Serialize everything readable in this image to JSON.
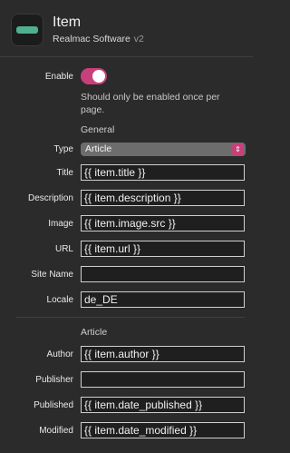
{
  "header": {
    "title": "Item",
    "vendor": "Realmac Software",
    "version": "v2"
  },
  "enable": {
    "label": "Enable",
    "on": true,
    "note": "Should only be enabled once per page."
  },
  "general": {
    "section_title": "General",
    "type_label": "Type",
    "type_value": "Article",
    "fields": [
      {
        "label": "Title",
        "value": "{{ item.title }}"
      },
      {
        "label": "Description",
        "value": "{{ item.description }}"
      },
      {
        "label": "Image",
        "value": "{{ item.image.src }}"
      },
      {
        "label": "URL",
        "value": "{{ item.url }}"
      },
      {
        "label": "Site Name",
        "value": ""
      },
      {
        "label": "Locale",
        "value": "de_DE"
      }
    ]
  },
  "article": {
    "section_title": "Article",
    "fields": [
      {
        "label": "Author",
        "value": "{{ item.author }}"
      },
      {
        "label": "Publisher",
        "value": ""
      },
      {
        "label": "Published",
        "value": "{{ item.date_published }}"
      },
      {
        "label": "Modified",
        "value": "{{ item.date_modified }}"
      }
    ]
  },
  "colors": {
    "background": "#2b2b2b",
    "accent": "#c8407a",
    "icon": "#4fb08d"
  }
}
